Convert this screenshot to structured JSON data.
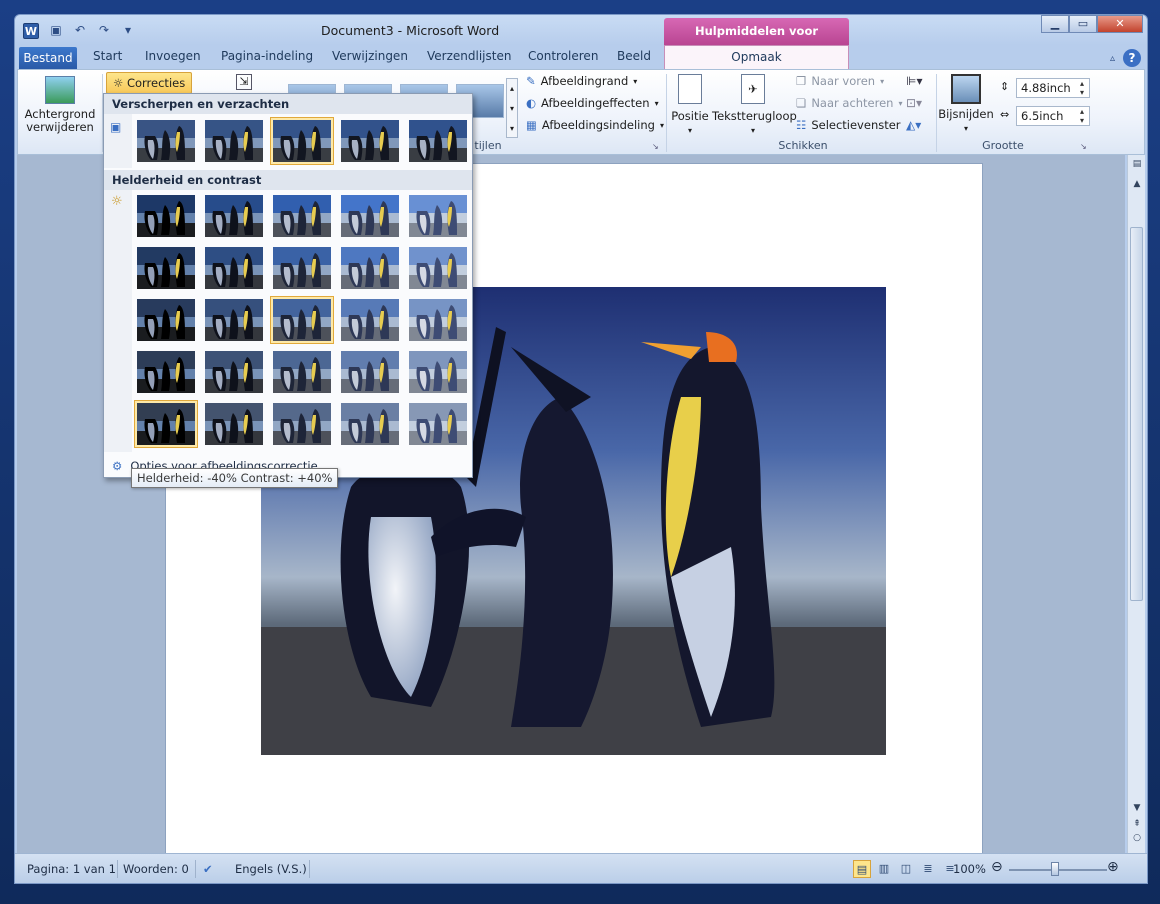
{
  "title": "Document3  -  Microsoft Word",
  "context_tab_header": "Hulpmiddelen voor afbeeldingen",
  "tabs": {
    "file": "Bestand",
    "items": [
      "Start",
      "Invoegen",
      "Pagina-indeling",
      "Verwijzingen",
      "Verzendlijsten",
      "Controleren",
      "Beeld"
    ],
    "context": "Opmaak"
  },
  "ribbon": {
    "remove_background": "Achtergrond verwijderen",
    "correcties": "Correcties",
    "afbeeldingrand": "Afbeeldingrand",
    "afbeeldingeffecten": "Afbeeldingeffecten",
    "afbeeldingsindeling": "Afbeeldingsindeling",
    "stijlen_label_partial": "tijlen",
    "positie": "Positie",
    "tekstterugloop": "Tekstterugloop",
    "naar_voren": "Naar voren",
    "naar_achteren": "Naar achteren",
    "selectievenster": "Selectievenster",
    "schikken_label": "Schikken",
    "bijsnijden": "Bijsnijden",
    "height_value": "4.88inch",
    "width_value": "6.5inch",
    "grootte_label": "Grootte"
  },
  "gallery": {
    "section1": "Verscherpen en verzachten",
    "section2": "Helderheid en contrast",
    "options_link": "Opties voor afbeeldingscorrectie...",
    "tooltip": "Helderheid: -40% Contrast: +40%",
    "sharpen_selected_index": 2,
    "bright_selected": [
      [
        2,
        2
      ],
      [
        4,
        0
      ]
    ]
  },
  "status": {
    "page": "Pagina: 1 van 1",
    "words": "Woorden: 0",
    "language": "Engels (V.S.)",
    "zoom": "100%"
  },
  "colors": {
    "context_tab": "#c24f9e",
    "file_tab": "#2f64b5",
    "selection": "#fde58b"
  }
}
